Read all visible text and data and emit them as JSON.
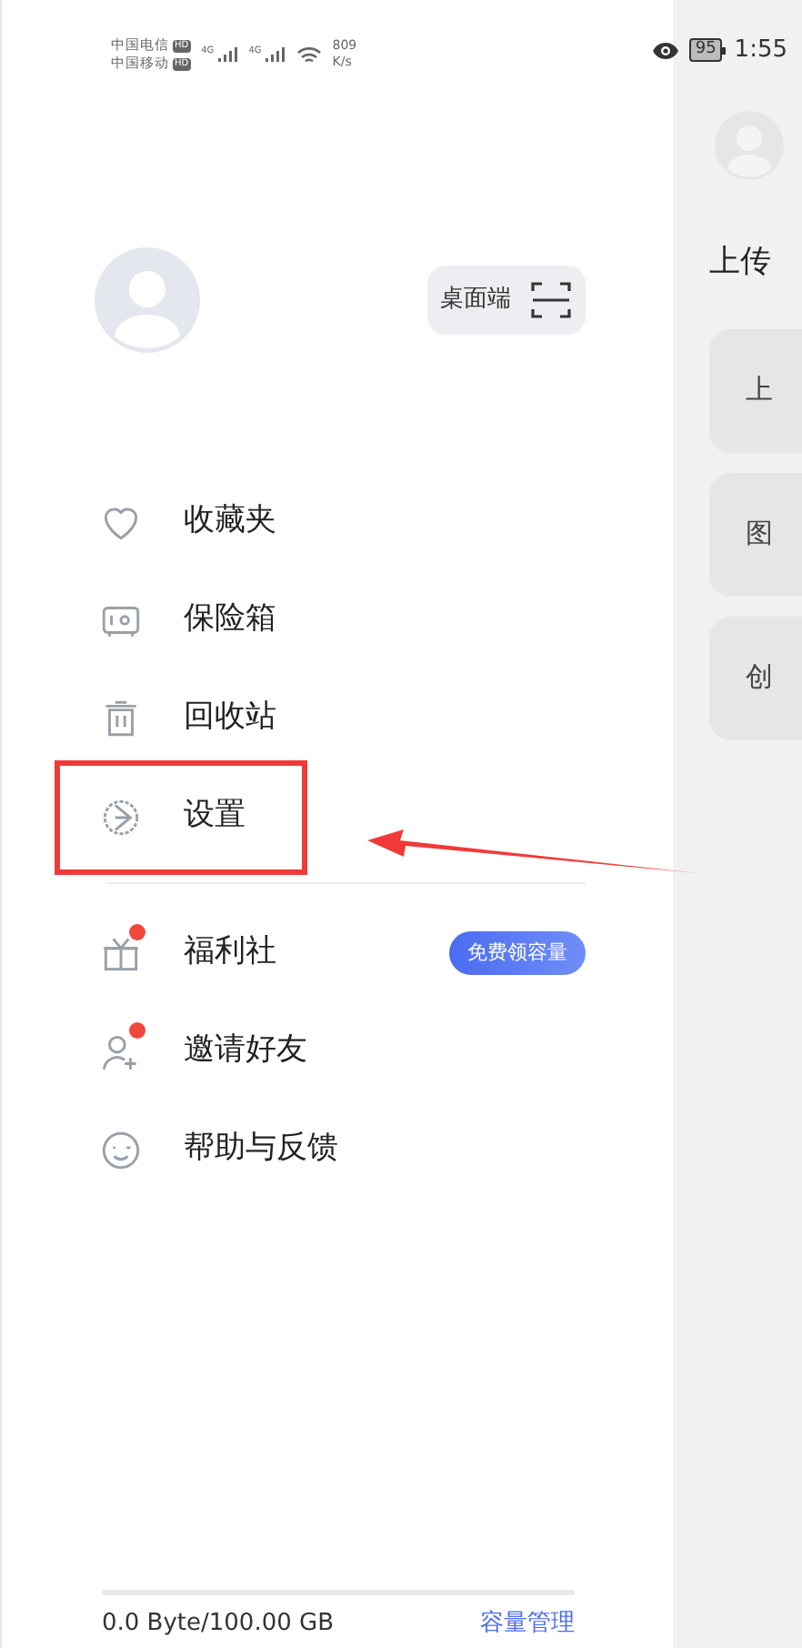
{
  "status_bar": {
    "carriers": [
      {
        "name": "中国电信",
        "tag": "HD"
      },
      {
        "name": "中国移动",
        "tag": "HD"
      }
    ],
    "signals": [
      "4G",
      "4G"
    ],
    "speed": "809",
    "speed_unit": "K/s",
    "battery": "95",
    "time": "1:55"
  },
  "drawer": {
    "desktop_button": "桌面端",
    "menu_groups": [
      [
        {
          "label": "收藏夹",
          "dot": false
        },
        {
          "label": "保险箱",
          "dot": false
        },
        {
          "label": "回收站",
          "dot": false
        },
        {
          "label": "设置",
          "dot": false
        }
      ],
      [
        {
          "label": "福利社",
          "dot": true,
          "tag": "免费领容量"
        },
        {
          "label": "邀请好友",
          "dot": true
        },
        {
          "label": "帮助与反馈",
          "dot": false
        }
      ]
    ],
    "storage": {
      "level": 0,
      "usage": "0.0 Byte/100.00 GB",
      "link": "容量管理"
    }
  },
  "background_page": {
    "heading": "上传",
    "cards": [
      "上",
      "图",
      "创"
    ]
  }
}
